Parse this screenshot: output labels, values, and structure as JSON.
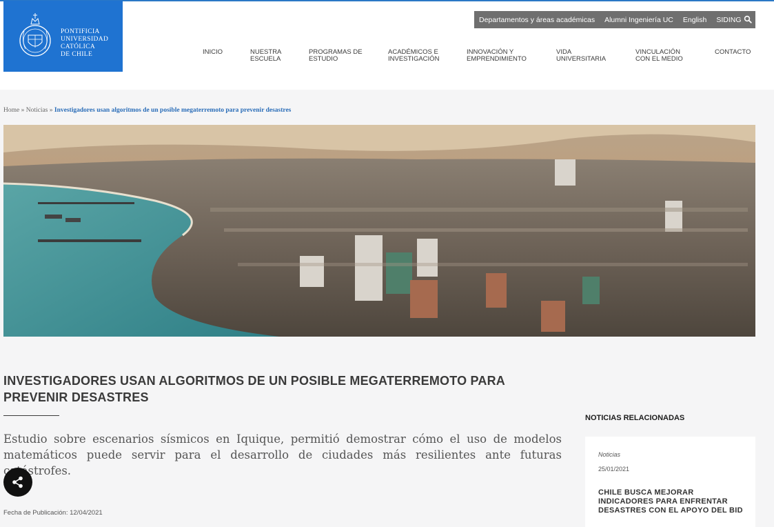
{
  "header": {
    "logo_lines": [
      "PONTIFICIA",
      "UNIVERSIDAD",
      "CATÓLICA",
      "DE CHILE"
    ],
    "utility_links": [
      "Departamentos y áreas académicas",
      "Alumni Ingeniería UC",
      "English",
      "SIDING"
    ],
    "main_nav": [
      {
        "line1": "INICIO",
        "line2": ""
      },
      {
        "line1": "NUESTRA",
        "line2": "ESCUELA"
      },
      {
        "line1": "PROGRAMAS DE",
        "line2": "ESTUDIO"
      },
      {
        "line1": "ACADÉMICOS E",
        "line2": "INVESTIGACIÓN"
      },
      {
        "line1": "INNOVACIÓN Y",
        "line2": "EMPRENDIMIENTO"
      },
      {
        "line1": "VIDA",
        "line2": "UNIVERSITARIA"
      },
      {
        "line1": "VINCULACIÓN",
        "line2": "CON EL MEDIO"
      },
      {
        "line1": "CONTACTO",
        "line2": ""
      }
    ]
  },
  "breadcrumb": {
    "home": "Home",
    "sep": " » ",
    "section": "Noticias",
    "current": "Investigadores usan algoritmos de un posible megaterremoto para prevenir desastres"
  },
  "article": {
    "title": "INVESTIGADORES USAN ALGORITMOS DE UN POSIBLE MEGATERREMOTO PARA PREVENIR DESASTRES",
    "lead": "Estudio sobre escenarios sísmicos en Iquique, permitió demostrar cómo el uso de modelos matemáticos puede servir para el desarrollo de ciudades más resilientes ante futuras catástrofes.",
    "publication_date": "Fecha de Publicación: 12/04/2021"
  },
  "related": {
    "heading": "NOTICIAS RELACIONADAS",
    "items": [
      {
        "category": "Noticias",
        "date": "25/01/2021",
        "title": "CHILE BUSCA MEJORAR INDICADORES PARA ENFRENTAR DESASTRES CON EL APOYO DEL BID"
      }
    ]
  },
  "colors": {
    "brand_blue": "#1f73d1",
    "utility_bar": "#6f6f6f",
    "breadcrumb_current": "#2a6db8"
  },
  "icons": [
    "university-seal-icon",
    "search-icon",
    "share-icon"
  ]
}
